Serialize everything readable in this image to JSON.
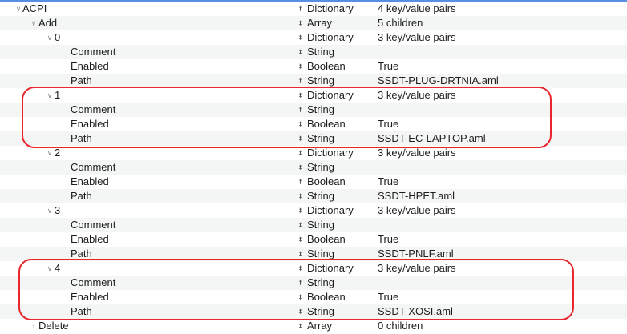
{
  "editor": {
    "accent_color": "#5a8ee6",
    "annotation_color": "#e8262b",
    "rows": [
      {
        "key": "ACPI",
        "type": "Dictionary",
        "value": "4 key/value pairs",
        "depth": 0,
        "expanded": true
      },
      {
        "key": "Add",
        "type": "Array",
        "value": "5 children",
        "depth": 1,
        "expanded": true
      },
      {
        "key": "0",
        "type": "Dictionary",
        "value": "3 key/value pairs",
        "depth": 2,
        "expanded": true
      },
      {
        "key": "Comment",
        "type": "String",
        "value": "",
        "depth": 3
      },
      {
        "key": "Enabled",
        "type": "Boolean",
        "value": "True",
        "depth": 3
      },
      {
        "key": "Path",
        "type": "String",
        "value": "SSDT-PLUG-DRTNIA.aml",
        "depth": 3
      },
      {
        "key": "1",
        "type": "Dictionary",
        "value": "3 key/value pairs",
        "depth": 2,
        "expanded": true
      },
      {
        "key": "Comment",
        "type": "String",
        "value": "",
        "depth": 3
      },
      {
        "key": "Enabled",
        "type": "Boolean",
        "value": "True",
        "depth": 3
      },
      {
        "key": "Path",
        "type": "String",
        "value": "SSDT-EC-LAPTOP.aml",
        "depth": 3
      },
      {
        "key": "2",
        "type": "Dictionary",
        "value": "3 key/value pairs",
        "depth": 2,
        "expanded": true
      },
      {
        "key": "Comment",
        "type": "String",
        "value": "",
        "depth": 3
      },
      {
        "key": "Enabled",
        "type": "Boolean",
        "value": "True",
        "depth": 3
      },
      {
        "key": "Path",
        "type": "String",
        "value": "SSDT-HPET.aml",
        "depth": 3
      },
      {
        "key": "3",
        "type": "Dictionary",
        "value": "3 key/value pairs",
        "depth": 2,
        "expanded": true
      },
      {
        "key": "Comment",
        "type": "String",
        "value": "",
        "depth": 3
      },
      {
        "key": "Enabled",
        "type": "Boolean",
        "value": "True",
        "depth": 3
      },
      {
        "key": "Path",
        "type": "String",
        "value": "SSDT-PNLF.aml",
        "depth": 3
      },
      {
        "key": "4",
        "type": "Dictionary",
        "value": "3 key/value pairs",
        "depth": 2,
        "expanded": true
      },
      {
        "key": "Comment",
        "type": "String",
        "value": "",
        "depth": 3
      },
      {
        "key": "Enabled",
        "type": "Boolean",
        "value": "True",
        "depth": 3
      },
      {
        "key": "Path",
        "type": "String",
        "value": "SSDT-XOSI.aml",
        "depth": 3
      },
      {
        "key": "Delete",
        "type": "Array",
        "value": "0 children",
        "depth": 1,
        "expanded": false
      }
    ]
  }
}
